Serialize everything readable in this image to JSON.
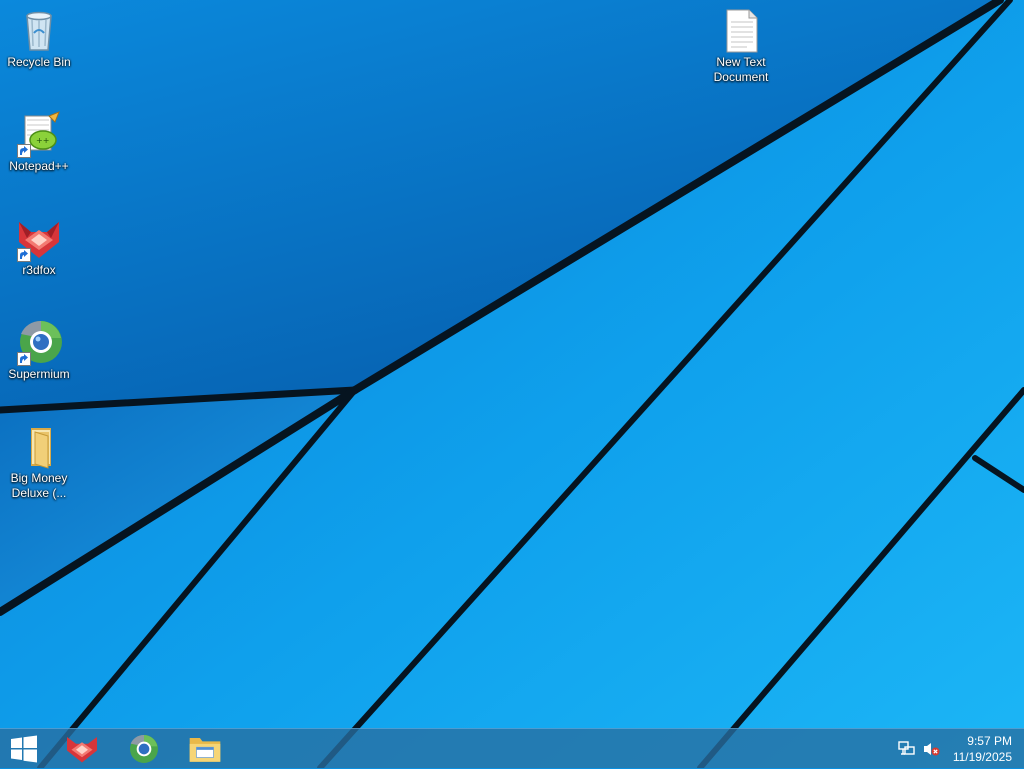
{
  "desktop": {
    "icons": [
      {
        "id": "recycle-bin",
        "label": "Recycle Bin",
        "icon": "recycle-bin-icon",
        "shortcut": false
      },
      {
        "id": "notepadpp",
        "label": "Notepad++",
        "icon": "notepadpp-icon",
        "shortcut": true
      },
      {
        "id": "r3dfox",
        "label": "r3dfox",
        "icon": "r3dfox-icon",
        "shortcut": true
      },
      {
        "id": "supermium",
        "label": "Supermium",
        "icon": "supermium-icon",
        "shortcut": true
      },
      {
        "id": "big-money",
        "label": "Big Money Deluxe (...",
        "icon": "folder-icon",
        "shortcut": false
      },
      {
        "id": "new-text-doc",
        "label": "New Text Document",
        "icon": "text-document-icon",
        "shortcut": false
      }
    ]
  },
  "taskbar": {
    "start": {
      "icon": "windows-logo-icon"
    },
    "pinned": [
      {
        "name": "r3dfox",
        "icon": "r3dfox-icon"
      },
      {
        "name": "Supermium",
        "icon": "supermium-icon"
      },
      {
        "name": "File Explorer",
        "icon": "file-explorer-icon"
      }
    ],
    "tray": {
      "network_icon": "network-icon",
      "volume_icon": "volume-muted-icon",
      "time": "9:57 PM",
      "date": "11/19/2025"
    }
  },
  "colors": {
    "wallpaper_light": "#19b4f5",
    "wallpaper_dark": "#0868b8",
    "taskbar": "#2c6fa3"
  }
}
